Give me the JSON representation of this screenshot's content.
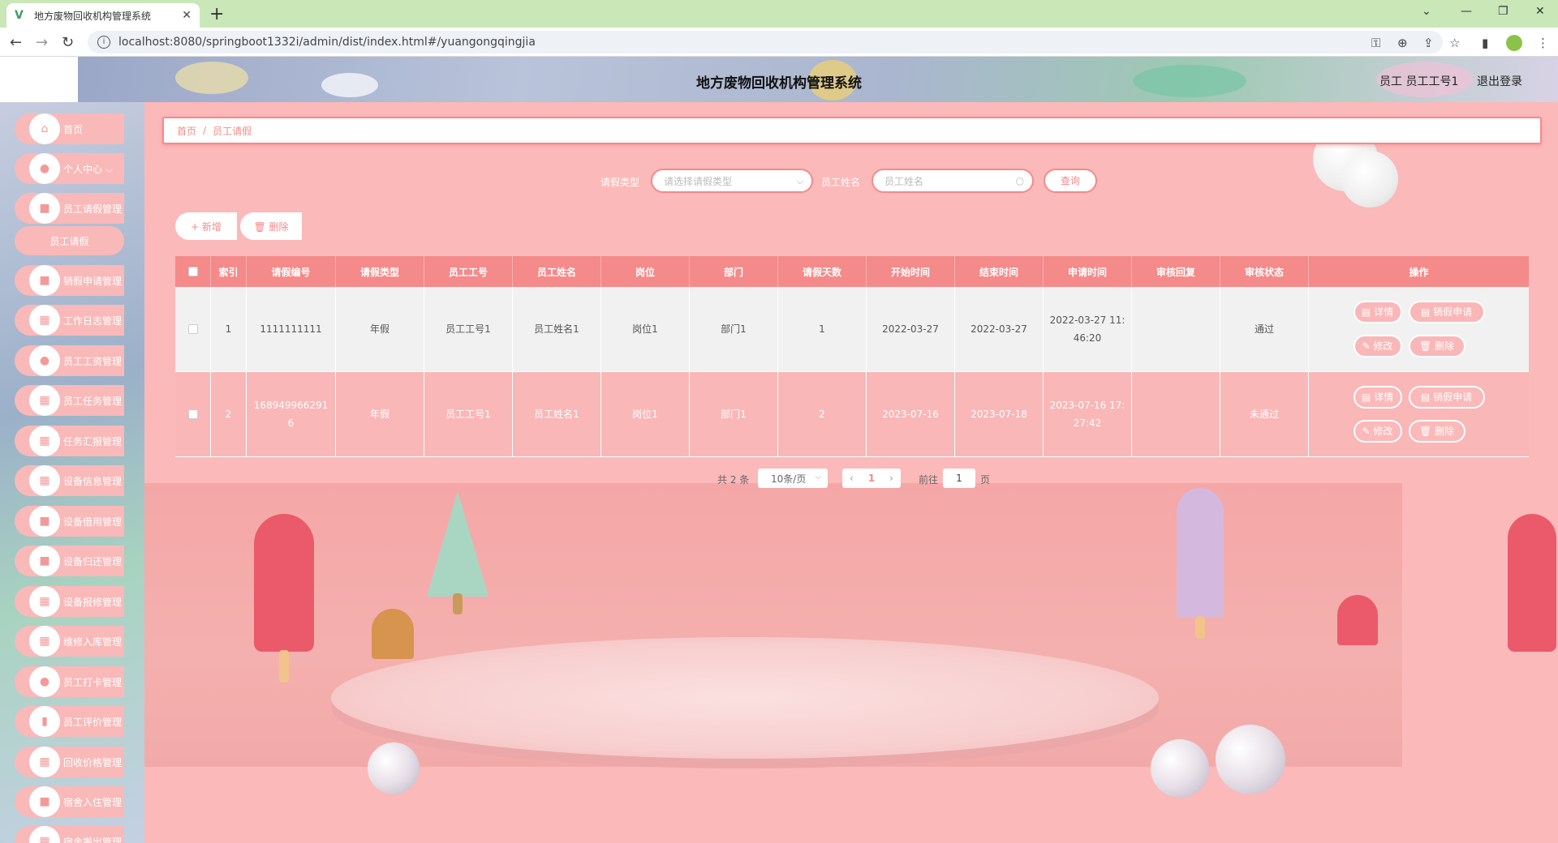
{
  "browser": {
    "tab_title": "地方废物回收机构管理系统",
    "tab_close": "✕",
    "new_tab": "+",
    "url": "localhost:8080/springboot1332i/admin/dist/index.html#/yuangongqingjia",
    "info_icon": "i",
    "icons": [
      "key-icon",
      "zoom-icon",
      "share-icon",
      "star-icon",
      "sidebar-icon",
      "profile-icon",
      "menu-icon"
    ]
  },
  "header": {
    "title": "地方废物回收机构管理系统",
    "user": "员工 员工工号1",
    "logout": "退出登录"
  },
  "sidebar": {
    "items": [
      {
        "label": "首页",
        "icon": "home-icon",
        "glyph": "⌂"
      },
      {
        "label": "个人中心 ⌵",
        "icon": "user-icon",
        "glyph": "●"
      },
      {
        "label": "员工请假管理",
        "icon": "chat-icon",
        "glyph": "■"
      },
      {
        "label": "销假申请管理",
        "icon": "briefcase-icon",
        "glyph": "■"
      },
      {
        "label": "工作日志管理",
        "icon": "grid-icon",
        "glyph": "▦"
      },
      {
        "label": "员工工资管理",
        "icon": "person-icon",
        "glyph": "●"
      },
      {
        "label": "员工任务管理",
        "icon": "grid-icon",
        "glyph": "▦"
      },
      {
        "label": "任务汇报管理",
        "icon": "grid-icon",
        "glyph": "▦"
      },
      {
        "label": "设备信息管理",
        "icon": "grid-icon",
        "glyph": "▦"
      },
      {
        "label": "设备借用管理",
        "icon": "monitor-icon",
        "glyph": "■"
      },
      {
        "label": "设备归还管理",
        "icon": "chat-icon",
        "glyph": "■"
      },
      {
        "label": "设备报修管理",
        "icon": "grid-icon",
        "glyph": "▦"
      },
      {
        "label": "维修入库管理",
        "icon": "grid-icon",
        "glyph": "▦"
      },
      {
        "label": "员工打卡管理",
        "icon": "location-icon",
        "glyph": "●"
      },
      {
        "label": "员工评价管理",
        "icon": "chart-icon",
        "glyph": "▮"
      },
      {
        "label": "回收价格管理",
        "icon": "grid-icon",
        "glyph": "▦"
      },
      {
        "label": "宿舍入住管理",
        "icon": "building-icon",
        "glyph": "■"
      },
      {
        "label": "宿舍搬出管理",
        "icon": "grid-icon",
        "glyph": "▦"
      }
    ],
    "submenu_active": "员工请假"
  },
  "breadcrumb": {
    "home": "首页",
    "separator": "/",
    "current": "员工请假"
  },
  "search": {
    "type_label": "请假类型",
    "type_placeholder": "请选择请假类型",
    "name_label": "员工姓名",
    "name_placeholder": "员工姓名",
    "query_button": "查询"
  },
  "actions": {
    "add": "+ 新增",
    "delete": "🗑 删除"
  },
  "table": {
    "columns": [
      "",
      "索引",
      "请假编号",
      "请假类型",
      "员工工号",
      "员工姓名",
      "岗位",
      "部门",
      "请假天数",
      "开始时间",
      "结束时间",
      "申请时间",
      "审核回复",
      "审核状态",
      "操作"
    ],
    "rows": [
      {
        "index": "1",
        "code": "1111111111",
        "type": "年假",
        "emp_no": "员工工号1",
        "emp_name": "员工姓名1",
        "post": "岗位1",
        "dept": "部门1",
        "days": "1",
        "start": "2022-03-27",
        "end": "2022-03-27",
        "applied": "2022-03-27 11:46:20",
        "reply": "",
        "status": "通过"
      },
      {
        "index": "2",
        "code": "1689499662916",
        "type": "年假",
        "emp_no": "员工工号1",
        "emp_name": "员工姓名1",
        "post": "岗位1",
        "dept": "部门1",
        "days": "2",
        "start": "2023-07-16",
        "end": "2023-07-18",
        "applied": "2023-07-16 17:27:42",
        "reply": "",
        "status": "未通过"
      }
    ],
    "ops": {
      "detail": "▤ 详情",
      "cancel_leave": "▤ 销假申请",
      "edit": "✎ 修改",
      "delete": "🗑 删除"
    }
  },
  "pager": {
    "total": "共 2 条",
    "page_size": "10条/页",
    "prev": "‹",
    "current_page": "1",
    "next": "›",
    "goto_label": "前往",
    "goto_value": "1",
    "page_suffix": "页"
  },
  "colors": {
    "accent": "#f48a8a",
    "background": "#fbb9b9",
    "header_bar": "#c9e7b7"
  }
}
